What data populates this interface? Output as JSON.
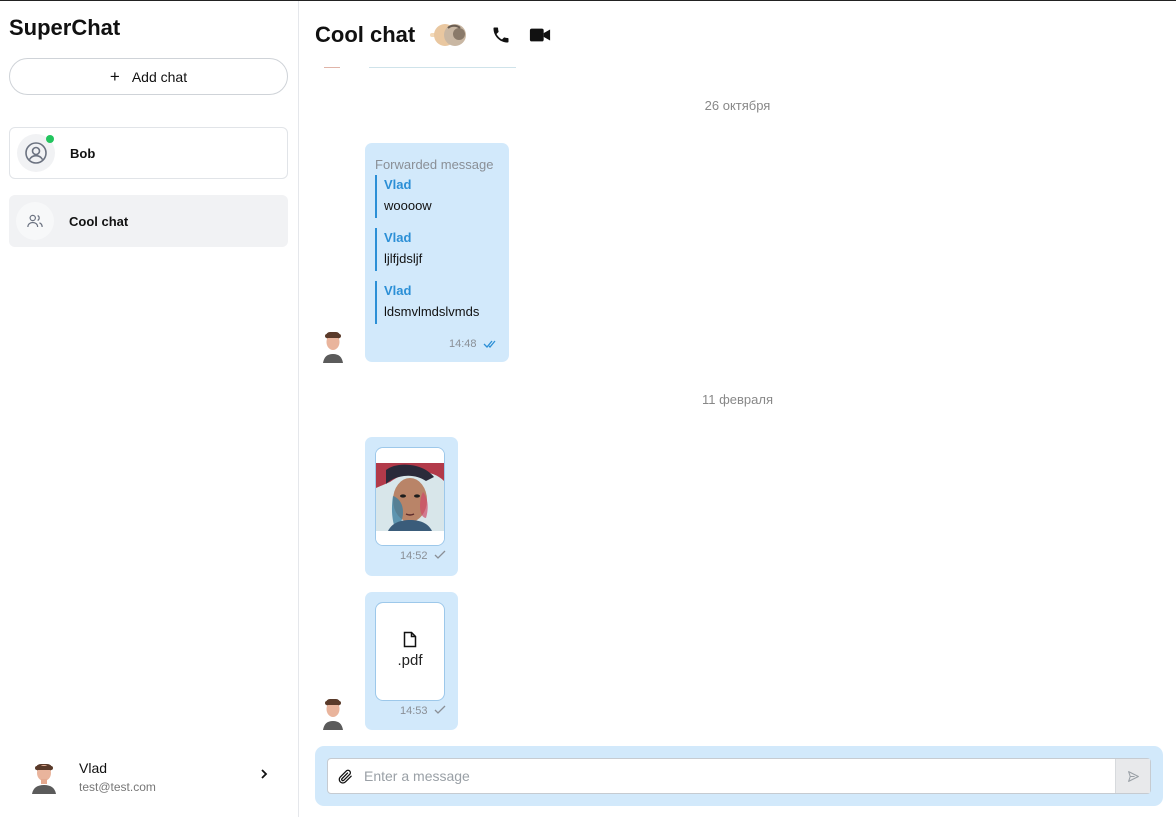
{
  "app": {
    "title": "SuperChat"
  },
  "sidebar": {
    "add_chat_label": "Add chat",
    "chats": [
      {
        "name": "Bob",
        "type": "user",
        "online": true
      },
      {
        "name": "Cool chat",
        "type": "group",
        "selected": true
      }
    ],
    "profile": {
      "name": "Vlad",
      "email": "test@test.com"
    }
  },
  "header": {
    "title": "Cool chat"
  },
  "messages": {
    "date_1": "26 октября",
    "forwarded": {
      "label": "Forwarded message",
      "items": [
        {
          "author": "Vlad",
          "text": "woooow"
        },
        {
          "author": "Vlad",
          "text": "ljlfjdsljf"
        },
        {
          "author": "Vlad",
          "text": "ldsmvlmdslvmds"
        }
      ],
      "time": "14:48",
      "status": "read"
    },
    "date_2": "11 февраля",
    "image_message": {
      "time": "14:52",
      "status": "sent"
    },
    "file_message": {
      "extension": ".pdf",
      "time": "14:53",
      "status": "sent"
    }
  },
  "composer": {
    "placeholder": "Enter a message"
  },
  "colors": {
    "bubble": "#d2e9fb",
    "accent": "#2b8fd6",
    "online": "#22c55e",
    "selected_chat": "#f1f2f4"
  },
  "icons": [
    "plus-icon",
    "user-icon",
    "group-icon",
    "chevron-right-icon",
    "phone-icon",
    "video-icon",
    "double-check-icon",
    "check-icon",
    "file-icon",
    "paperclip-icon",
    "send-icon"
  ]
}
